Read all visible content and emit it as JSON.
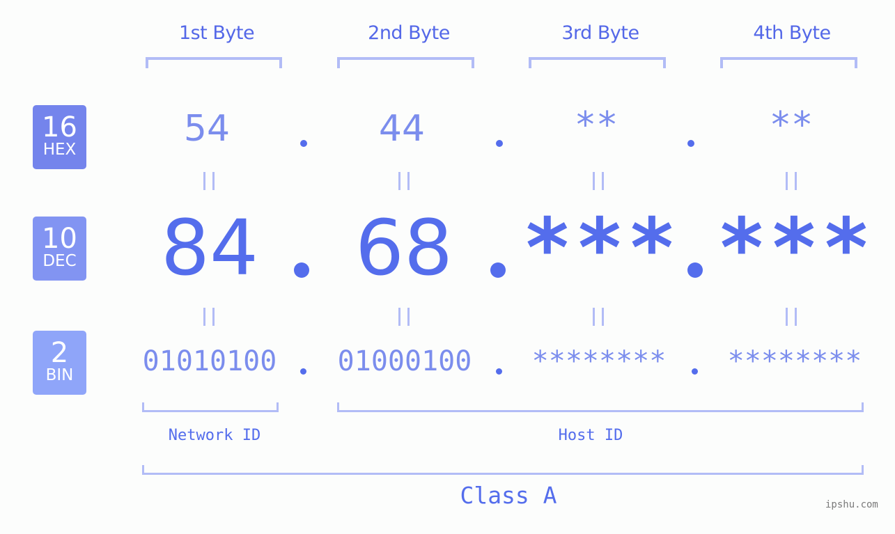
{
  "bytes": {
    "headers": [
      "1st Byte",
      "2nd Byte",
      "3rd Byte",
      "4th Byte"
    ]
  },
  "bases": {
    "hex": {
      "num": "16",
      "label": "HEX",
      "color": "#7484ec"
    },
    "dec": {
      "num": "10",
      "label": "DEC",
      "color": "#8294f2"
    },
    "bin": {
      "num": "2",
      "label": "BIN",
      "color": "#8fa5f9"
    }
  },
  "ip": {
    "hex": [
      "54",
      "44",
      "**",
      "**"
    ],
    "dec": [
      "84",
      "68",
      "***",
      "***"
    ],
    "bin": [
      "01010100",
      "01000100",
      "********",
      "********"
    ],
    "separator": "."
  },
  "equals_symbol": "=",
  "segments": {
    "network": "Network ID",
    "host": "Host ID",
    "class": "Class A"
  },
  "watermark": "ipshu.com",
  "colors": {
    "accent": "#546dec",
    "light_accent": "#7b8ded",
    "bracket": "#b2bcf6"
  }
}
